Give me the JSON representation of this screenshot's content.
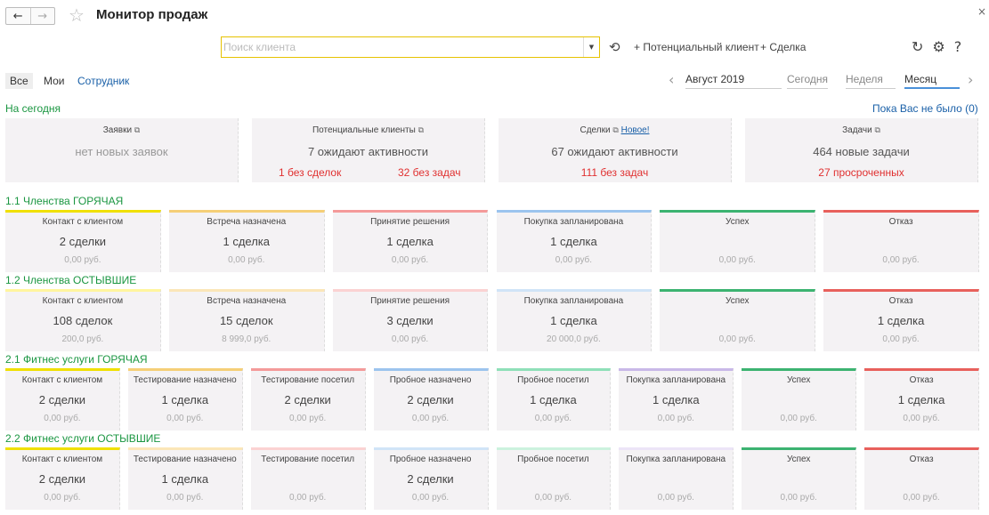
{
  "window": {
    "title": "Монитор продаж",
    "back": "←",
    "forward": "→",
    "star": "☆",
    "close": "×"
  },
  "toolbar": {
    "search_placeholder": "Поиск клиента",
    "history_icon": "⟲",
    "add_lead": "+ Потенциальный клиент",
    "add_deal": "+ Сделка",
    "refresh": "↻",
    "gear": "⚙",
    "help": "?"
  },
  "filters": {
    "all": "Все",
    "mine": "Мои",
    "employee": "Сотрудник"
  },
  "period": {
    "month_value": "Август 2019",
    "today": "Сегодня",
    "week": "Неделя",
    "month": "Месяц"
  },
  "today": {
    "label": "На сегодня",
    "last_visit": "Пока Вас не было (0)",
    "cards": [
      {
        "title": "Заявки",
        "value": "нет новых заявок"
      },
      {
        "title": "Потенциальные клиенты",
        "value": "7 ожидают активности",
        "red1": "1 без сделок",
        "red2": "32 без задач"
      },
      {
        "title": "Сделки",
        "new_link": "Новое!",
        "value": "67 ожидают активности",
        "red": "111 без задач"
      },
      {
        "title": "Задачи",
        "value": "464 новые задачи",
        "red": "27 просроченных"
      }
    ]
  },
  "sections": [
    {
      "title": "1.1 Членства ГОРЯЧАЯ",
      "stages": [
        {
          "name": "Контакт с клиентом",
          "count": "2 сделки",
          "sum": "0,00 руб.",
          "color": "#f0e000"
        },
        {
          "name": "Встреча назначена",
          "count": "1 сделка",
          "sum": "0,00 руб.",
          "color": "#f5cf77"
        },
        {
          "name": "Принятие решения",
          "count": "1 сделка",
          "sum": "0,00 руб.",
          "color": "#f49a9a"
        },
        {
          "name": "Покупка запланирована",
          "count": "1 сделка",
          "sum": "0,00 руб.",
          "color": "#9cc4ee"
        },
        {
          "name": "Успех",
          "count": "",
          "sum": "0,00 руб.",
          "color": "#3cb371"
        },
        {
          "name": "Отказ",
          "count": "",
          "sum": "0,00 руб.",
          "color": "#e8605c"
        }
      ]
    },
    {
      "title": "1.2 Членства ОСТЫВШИЕ",
      "stages": [
        {
          "name": "Контакт с клиентом",
          "count": "108 сделок",
          "sum": "200,0 руб.",
          "color": "#fff59e"
        },
        {
          "name": "Встреча назначена",
          "count": "15 сделок",
          "sum": "8 999,0 руб.",
          "color": "#fbe6b8"
        },
        {
          "name": "Принятие решения",
          "count": "3 сделки",
          "sum": "0,00 руб.",
          "color": "#fbd2d2"
        },
        {
          "name": "Покупка запланирована",
          "count": "1 сделка",
          "sum": "20 000,0 руб.",
          "color": "#d0e4f7"
        },
        {
          "name": "Успех",
          "count": "",
          "sum": "0,00 руб.",
          "color": "#3cb371"
        },
        {
          "name": "Отказ",
          "count": "1 сделка",
          "sum": "0,00 руб.",
          "color": "#e8605c"
        }
      ]
    },
    {
      "title": "2.1 Фитнес услуги ГОРЯЧАЯ",
      "stages": [
        {
          "name": "Контакт с клиентом",
          "count": "2 сделки",
          "sum": "0,00 руб.",
          "color": "#f0e000"
        },
        {
          "name": "Тестирование назначено",
          "count": "1 сделка",
          "sum": "0,00 руб.",
          "color": "#f5cf77"
        },
        {
          "name": "Тестирование посетил",
          "count": "2 сделки",
          "sum": "0,00 руб.",
          "color": "#f49a9a"
        },
        {
          "name": "Пробное назначено",
          "count": "2 сделки",
          "sum": "0,00 руб.",
          "color": "#9cc4ee"
        },
        {
          "name": "Пробное посетил",
          "count": "1 сделка",
          "sum": "0,00 руб.",
          "color": "#8fe0b8"
        },
        {
          "name": "Покупка запланирована",
          "count": "1 сделка",
          "sum": "0,00 руб.",
          "color": "#c9b8e8"
        },
        {
          "name": "Успех",
          "count": "",
          "sum": "0,00 руб.",
          "color": "#3cb371"
        },
        {
          "name": "Отказ",
          "count": "1 сделка",
          "sum": "0,00 руб.",
          "color": "#e8605c"
        }
      ]
    },
    {
      "title": "2.2 Фитнес услуги ОСТЫВШИЕ",
      "stages": [
        {
          "name": "Контакт с клиентом",
          "count": "2 сделки",
          "sum": "0,00 руб.",
          "color": "#f0e000"
        },
        {
          "name": "Тестирование назначено",
          "count": "1 сделка",
          "sum": "0,00 руб.",
          "color": "#fbe6b8"
        },
        {
          "name": "Тестирование посетил",
          "count": "",
          "sum": "0,00 руб.",
          "color": "#fbd2d2"
        },
        {
          "name": "Пробное назначено",
          "count": "2 сделки",
          "sum": "0,00 руб.",
          "color": "#d0e4f7"
        },
        {
          "name": "Пробное посетил",
          "count": "",
          "sum": "0,00 руб.",
          "color": "#ccf2de"
        },
        {
          "name": "Покупка запланирована",
          "count": "",
          "sum": "0,00 руб.",
          "color": "#ece4f7"
        },
        {
          "name": "Успех",
          "count": "",
          "sum": "0,00 руб.",
          "color": "#3cb371"
        },
        {
          "name": "Отказ",
          "count": "",
          "sum": "0,00 руб.",
          "color": "#e8605c"
        }
      ]
    }
  ]
}
